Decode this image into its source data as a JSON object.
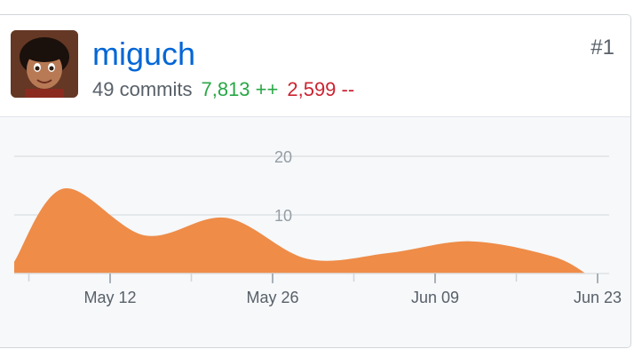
{
  "contributor": {
    "username": "miguch",
    "commits_text": "49 commits",
    "additions_text": "7,813 ++",
    "deletions_text": "2,599 --",
    "rank": "#1"
  },
  "colors": {
    "area": "#ee8c48",
    "link": "#0366d6",
    "additions": "#28a745",
    "deletions": "#cb2431"
  },
  "chart_data": {
    "type": "area",
    "x_ticks": [
      "May 12",
      "May 26",
      "Jun 09",
      "Jun 23"
    ],
    "y_ticks": [
      10,
      20
    ],
    "ylim": [
      0,
      20
    ],
    "x": [
      "May 01",
      "May 08",
      "May 15",
      "May 22",
      "May 29",
      "Jun 05",
      "Jun 12",
      "Jun 19",
      "Jun 24"
    ],
    "values": [
      2,
      14.5,
      6.5,
      9.5,
      2.5,
      3.5,
      5.5,
      3,
      0
    ],
    "grid": true
  }
}
